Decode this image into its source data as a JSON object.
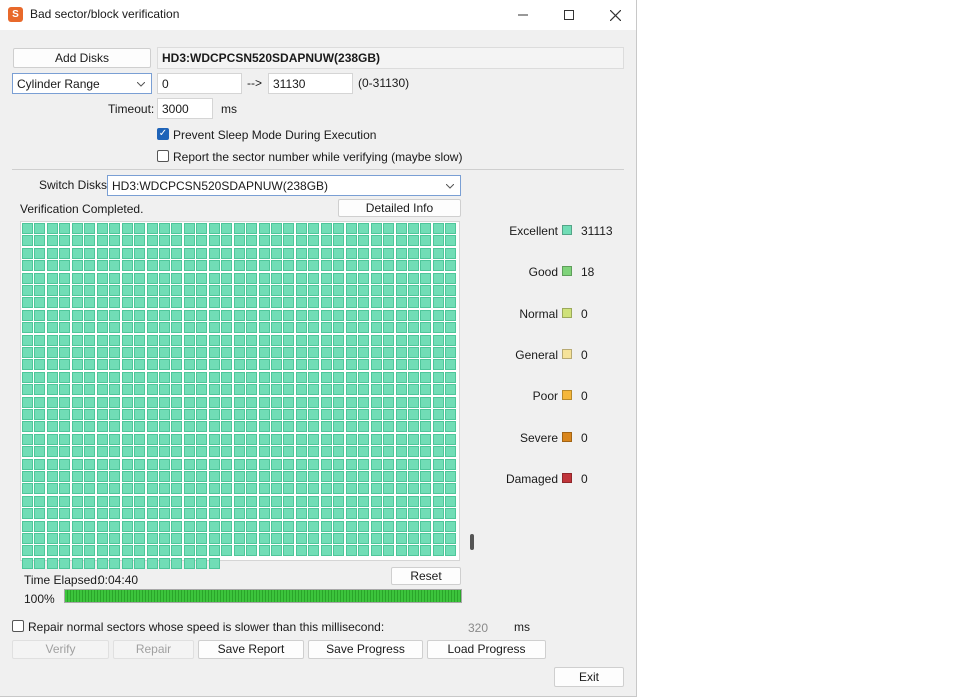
{
  "window": {
    "title": "Bad sector/block verification",
    "app_icon": "S"
  },
  "top": {
    "add_disks_label": "Add Disks",
    "disk_name": "HD3:WDCPCSN520SDAPNUW(238GB)",
    "range_mode": "Cylinder Range",
    "range_start": "0",
    "range_arrow": "-->",
    "range_end": "31130",
    "range_hint": "(0-31130)",
    "timeout_label": "Timeout:",
    "timeout_value": "3000",
    "timeout_unit": "ms",
    "prevent_sleep_label": "Prevent Sleep Mode During Execution",
    "prevent_sleep_checked": true,
    "report_sector_label": "Report the sector number while verifying (maybe slow)",
    "report_sector_checked": false
  },
  "mid": {
    "switch_disks_label": "Switch Disks:",
    "switch_disks_value": "HD3:WDCPCSN520SDAPNUW(238GB)",
    "status_text": "Verification Completed.",
    "detailed_info_label": "Detailed Info"
  },
  "grid": {
    "color": "#71ddb6",
    "border": "#4ec69a"
  },
  "legend": [
    {
      "label": "Excellent",
      "count": "31113",
      "color": "#71ddb6"
    },
    {
      "label": "Good",
      "count": "18",
      "color": "#7fd37a"
    },
    {
      "label": "Normal",
      "count": "0",
      "color": "#cfe27a"
    },
    {
      "label": "General",
      "count": "0",
      "color": "#f6e39a"
    },
    {
      "label": "Poor",
      "count": "0",
      "color": "#f5b73a"
    },
    {
      "label": "Severe",
      "count": "0",
      "color": "#d9861d"
    },
    {
      "label": "Damaged",
      "count": "0",
      "color": "#c0343a"
    }
  ],
  "bottom": {
    "time_elapsed_label": "Time Elapsed:",
    "time_elapsed_value": "0:04:40",
    "reset_label": "Reset",
    "progress_text": "100%",
    "progress_value": 1.0,
    "repair_slow_label": "Repair normal sectors whose speed is slower than this millisecond:",
    "repair_slow_checked": false,
    "repair_slow_value": "320",
    "repair_slow_unit": "ms",
    "verify_label": "Verify",
    "repair_label": "Repair",
    "save_report_label": "Save Report",
    "save_progress_label": "Save Progress",
    "load_progress_label": "Load Progress",
    "exit_label": "Exit"
  }
}
